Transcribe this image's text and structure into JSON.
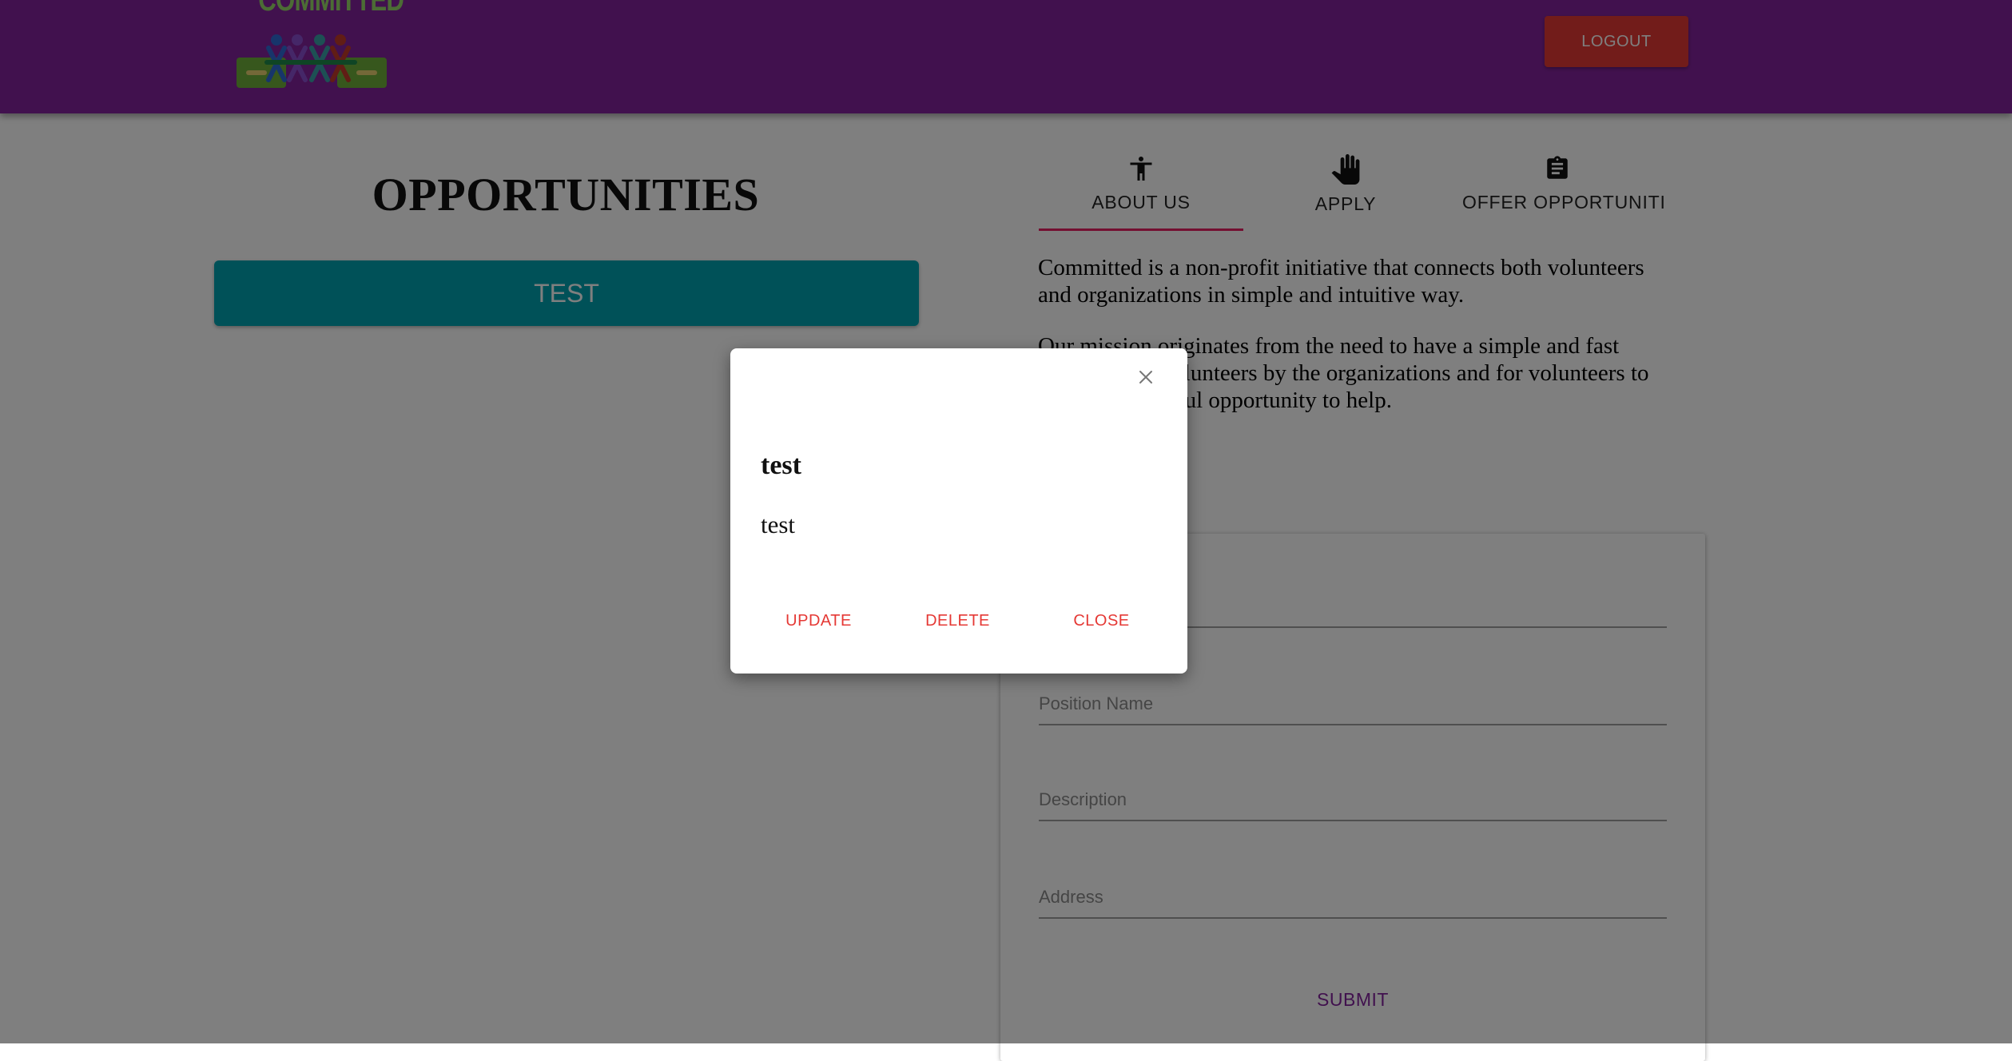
{
  "header": {
    "logo_text": "COMMITTED",
    "logout_label": "LOGOUT",
    "color": "#83239c",
    "logout_color": "#e53935"
  },
  "opportunities": {
    "title": "OPPORTUNITIES",
    "items": [
      {
        "label": "TEST",
        "color": "#00a3b0"
      }
    ]
  },
  "tabs": [
    {
      "label": "ABOUT US",
      "icon": "accessibility-icon",
      "active": true
    },
    {
      "label": "APPLY",
      "icon": "hand-icon",
      "active": false
    },
    {
      "label": "OFFER OPPORTUNITIES",
      "icon": "clipboard-icon",
      "active": false
    }
  ],
  "about": {
    "paragraph1": "Committed is a non-profit initiative that connects both volunteers and organizations in simple and intuitive way.",
    "paragraph2": "Our mission originates from the need to have a simple and fast access to the volunteers by the organizations and for volunteers to find a meaningful opportunity to help."
  },
  "form": {
    "fields": [
      {
        "placeholder": "",
        "value": ""
      },
      {
        "placeholder": "Position Name",
        "value": ""
      },
      {
        "placeholder": "Description",
        "value": ""
      },
      {
        "placeholder": "Address",
        "value": ""
      }
    ],
    "submit_label": "SUBMIT"
  },
  "modal": {
    "title": "test",
    "body": "test",
    "close_icon": "close-icon",
    "buttons": {
      "update": "UPDATE",
      "delete": "DELETE",
      "close": "CLOSE"
    },
    "button_color": "#e53935"
  }
}
